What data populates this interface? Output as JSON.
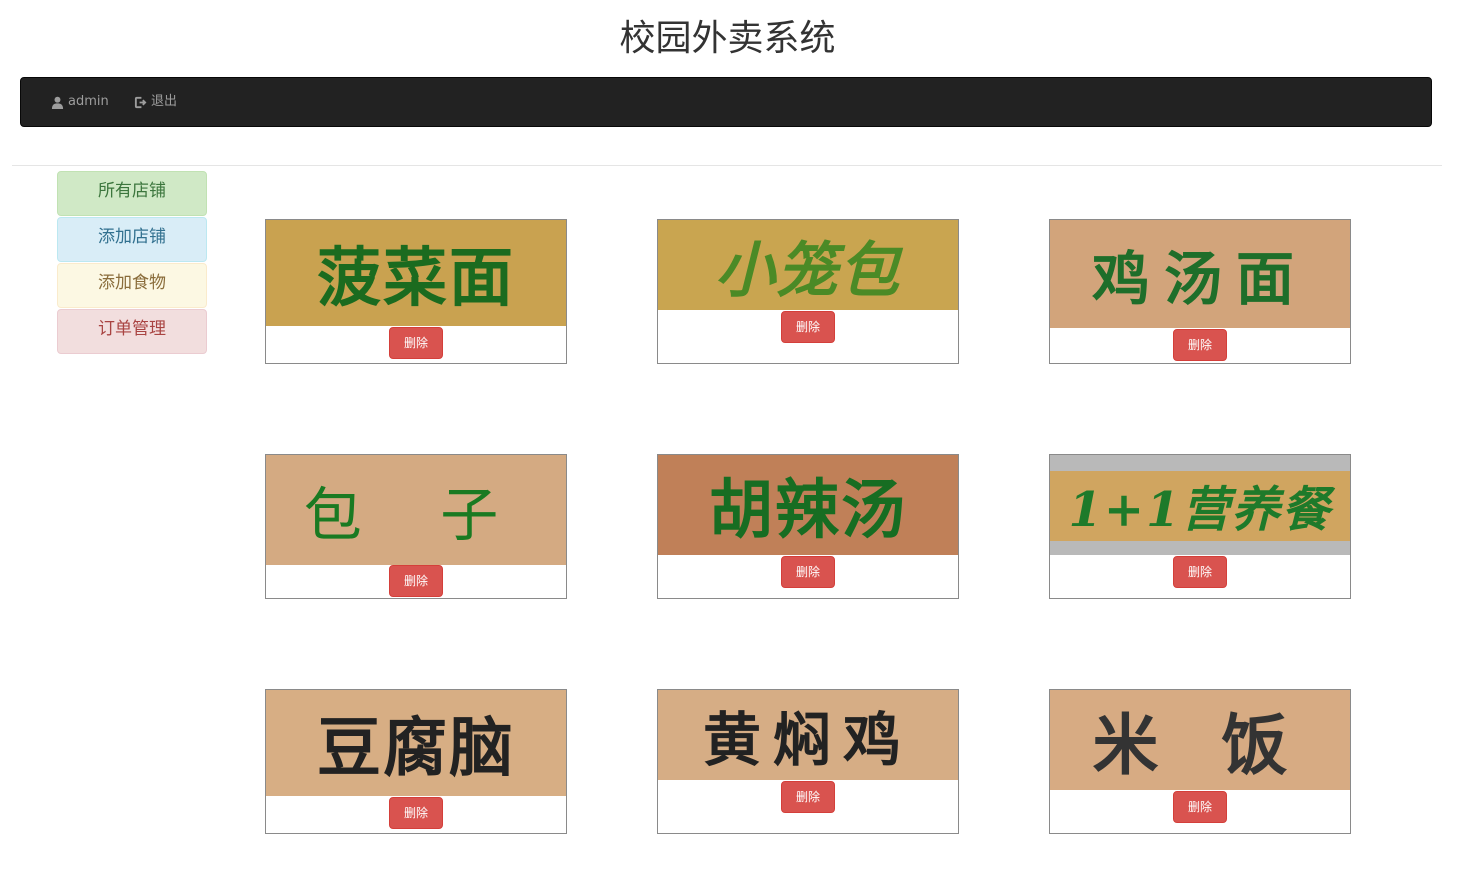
{
  "page": {
    "title": "校园外卖系统"
  },
  "navbar": {
    "user_label": "admin",
    "logout_label": "退出"
  },
  "sidebar": {
    "items": [
      {
        "label": "所有店铺",
        "style": "success"
      },
      {
        "label": "添加店铺",
        "style": "info"
      },
      {
        "label": "添加食物",
        "style": "warning"
      },
      {
        "label": "订单管理",
        "style": "danger"
      }
    ]
  },
  "shops": [
    {
      "name": "菠菜面",
      "bg": "#c9a250",
      "fg": "#1b6b1f",
      "delete_label": "删除"
    },
    {
      "name": "小笼包",
      "bg": "#c9a550",
      "fg": "#4b8a26",
      "delete_label": "删除"
    },
    {
      "name": "鸡汤面",
      "bg": "#d2a47b",
      "fg": "#1e6e2a",
      "delete_label": "删除"
    },
    {
      "name": "包 子",
      "bg": "#d4aa82",
      "fg": "#1a7a22",
      "delete_label": "删除"
    },
    {
      "name": "胡辣汤",
      "bg": "#c08058",
      "fg": "#176d22",
      "delete_label": "删除"
    },
    {
      "name": "1+1营养餐",
      "bg": "#d0a560",
      "fg": "#1e7a2a",
      "delete_label": "删除"
    },
    {
      "name": "豆腐脑",
      "bg": "#d7ae84",
      "fg": "#222222",
      "delete_label": "删除"
    },
    {
      "name": "黄焖鸡",
      "bg": "#d6ad85",
      "fg": "#222222",
      "delete_label": "删除"
    },
    {
      "name": "米 饭",
      "bg": "#d7ab83",
      "fg": "#333333",
      "delete_label": "删除"
    }
  ],
  "colors": {
    "navbar_bg": "#222222",
    "delete_button": "#d9534f"
  }
}
